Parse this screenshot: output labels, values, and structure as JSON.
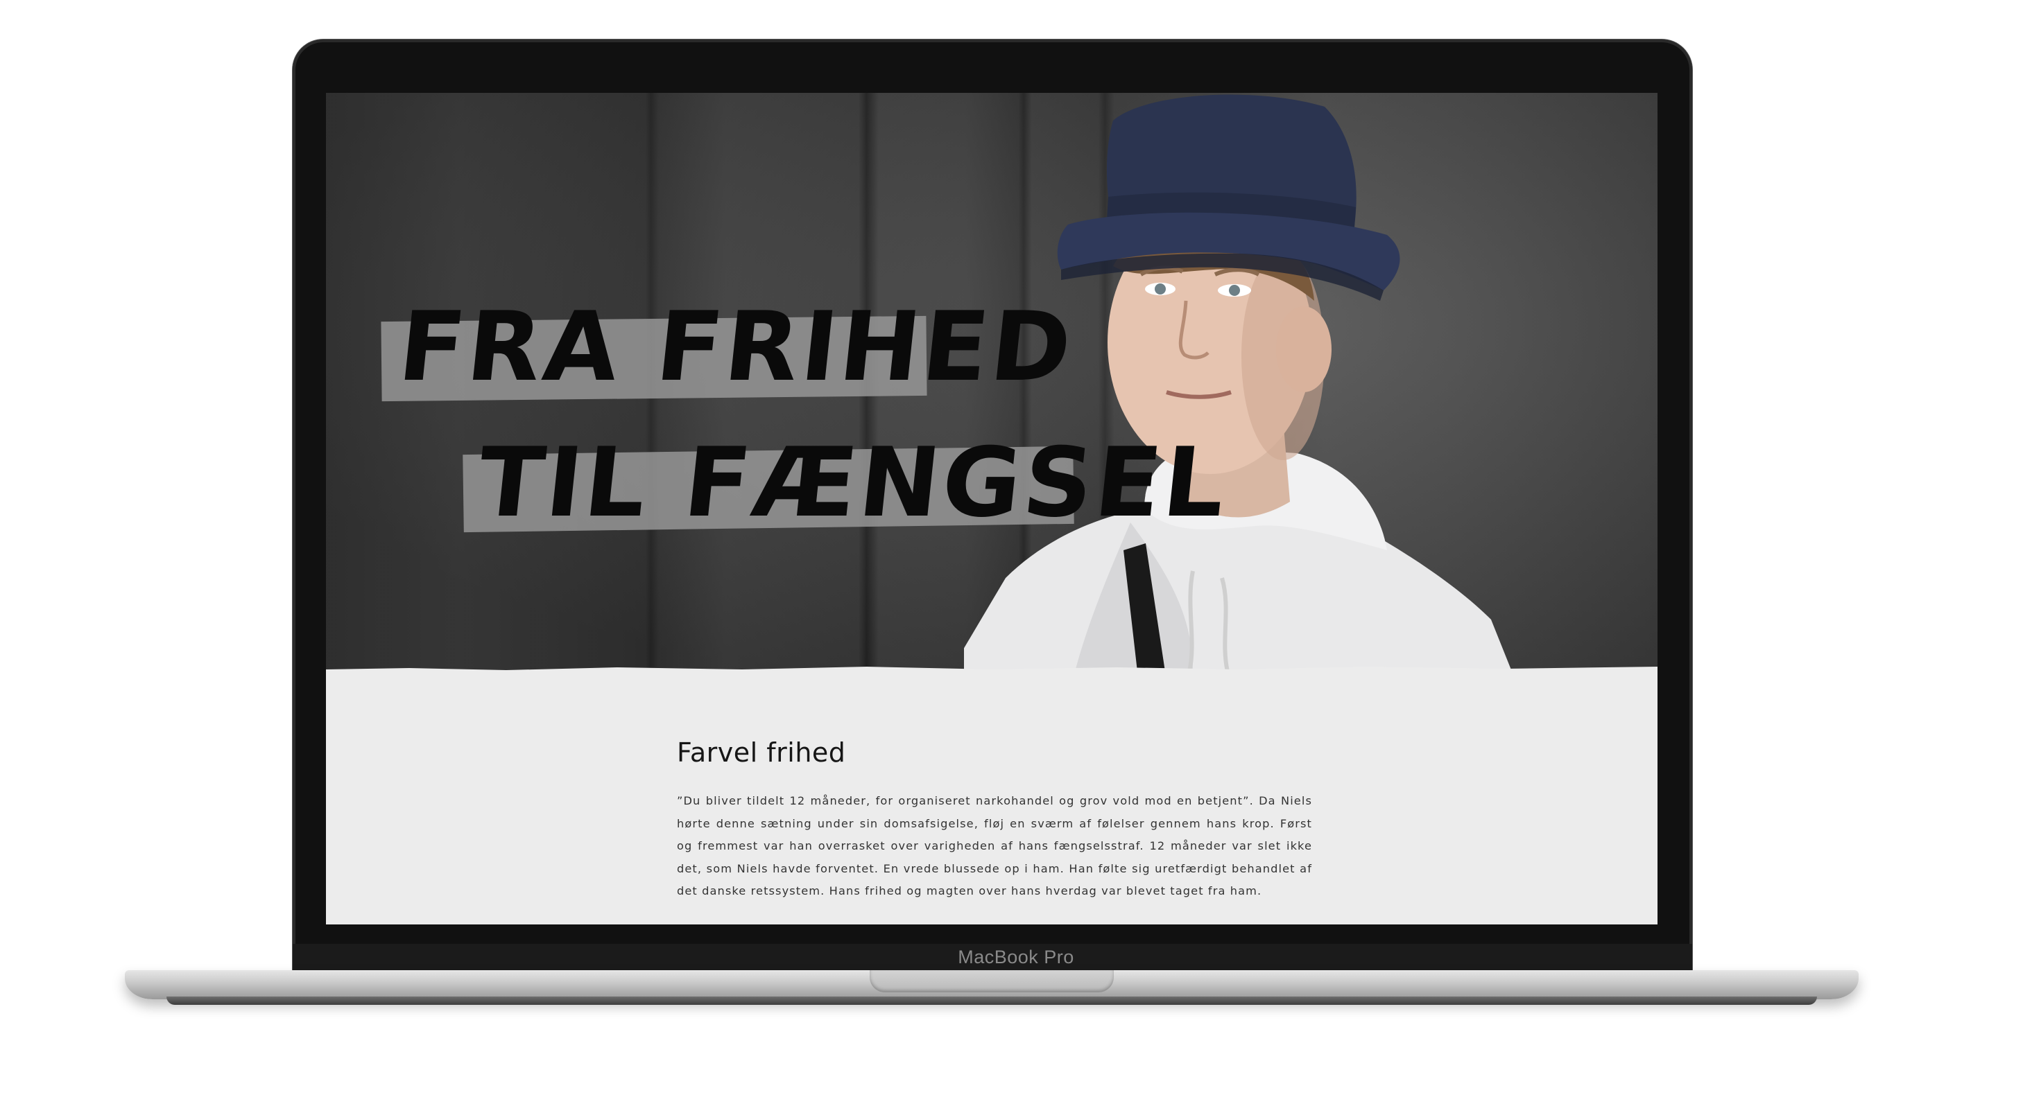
{
  "device": {
    "brand_label": "MacBook Pro"
  },
  "hero": {
    "headline_line1": "FRA FRIHED",
    "headline_line2": "TIL FÆNGSEL",
    "image_subject": "young-man-in-bucket-hat-portrait"
  },
  "article": {
    "title": "Farvel frihed",
    "body": "”Du bliver tildelt 12 måneder, for organiseret narkohandel og grov vold mod en betjent”. Da Niels hørte denne sætning under sin domsafsigelse, fløj en sværm af følelser gennem hans krop. Først og fremmest var han overrasket over varigheden af hans fængselsstraf. 12 måneder var slet ikke det, som Niels havde forventet. En vrede blussede op i ham. Han følte sig uretfærdigt behandlet af det danske retssystem. Hans frihed og magten over hans hverdag var blevet taget fra ham."
  },
  "colors": {
    "bezel": "#111111",
    "page_background": "#ececec",
    "headline_ink": "#0a0a0a",
    "tape": "#969696",
    "hat": "#2b3450"
  }
}
